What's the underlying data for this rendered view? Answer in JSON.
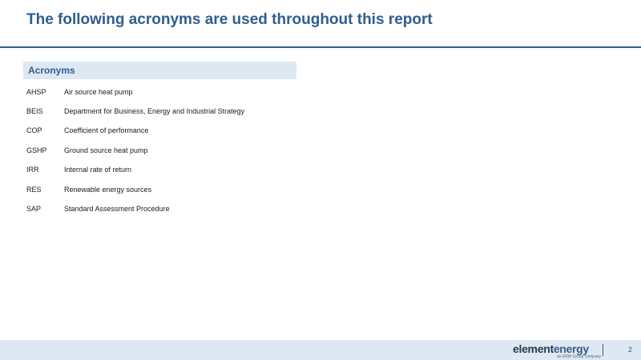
{
  "slide": {
    "title": "The following acronyms are used throughout this report",
    "section_header": "Acronyms",
    "page_number": "2"
  },
  "acronyms": [
    {
      "code": "AHSP",
      "description": "Air source heat pump"
    },
    {
      "code": "BEIS",
      "description": "Department for Business, Energy and Industrial Strategy"
    },
    {
      "code": "COP",
      "description": "Coefficient of performance"
    },
    {
      "code": "GSHP",
      "description": "Ground source heat pump"
    },
    {
      "code": "IRR",
      "description": "Internal rate of return"
    },
    {
      "code": "RES",
      "description": "Renewable energy sources"
    },
    {
      "code": "SAP",
      "description": "Standard Assessment Procedure"
    }
  ],
  "logo": {
    "part1": "element",
    "part2": "energy",
    "tagline": "an ERM Group company"
  },
  "colors": {
    "title": "#2f5e8e",
    "header_fill": "#dde8f3",
    "footer_fill": "#dde8f3"
  }
}
